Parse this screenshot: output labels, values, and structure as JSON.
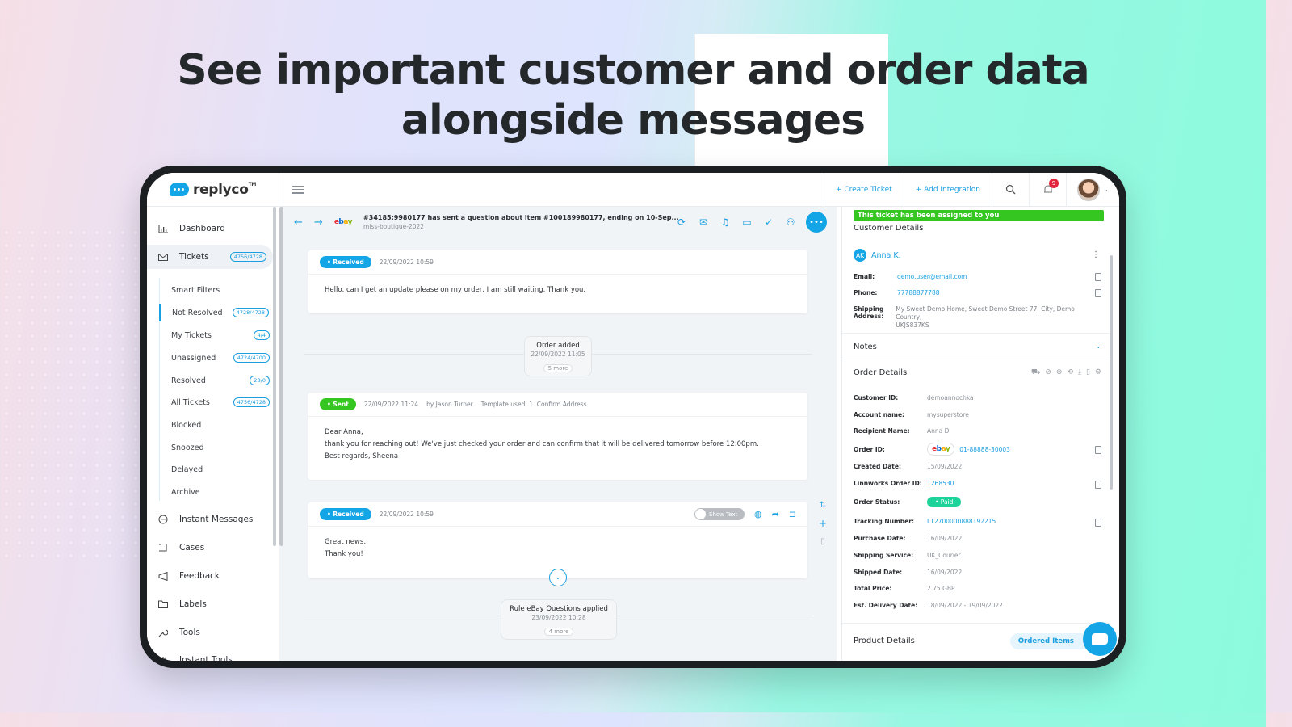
{
  "headline": {
    "line1": "See important customer and order data",
    "line2": "alongside messages"
  },
  "app": {
    "logo_text": "replyco",
    "logo_tm": "TM",
    "topbar": {
      "create_ticket": "+ Create Ticket",
      "add_integration": "+ Add Integration",
      "notification_count": "9"
    }
  },
  "sidebar": {
    "items": [
      {
        "label": "Dashboard",
        "icon": "chart-icon"
      },
      {
        "label": "Tickets",
        "icon": "mail-icon",
        "count": "4756/4728"
      },
      {
        "label": "Instant Messages",
        "icon": "chat-icon"
      },
      {
        "label": "Cases",
        "icon": "case-icon"
      },
      {
        "label": "Feedback",
        "icon": "megaphone-icon"
      },
      {
        "label": "Labels",
        "icon": "folder-icon"
      },
      {
        "label": "Tools",
        "icon": "wrench-icon"
      },
      {
        "label": "Instant Tools",
        "icon": "gear-icon"
      }
    ],
    "ticket_filters": [
      {
        "label": "Smart Filters"
      },
      {
        "label": "Not Resolved",
        "count": "4728/4728"
      },
      {
        "label": "My Tickets",
        "count": "4/4"
      },
      {
        "label": "Unassigned",
        "count": "4724/4700"
      },
      {
        "label": "Resolved",
        "count": "28/0"
      },
      {
        "label": "All Tickets",
        "count": "4756/4728"
      },
      {
        "label": "Blocked"
      },
      {
        "label": "Snoozed"
      },
      {
        "label": "Delayed"
      },
      {
        "label": "Archive"
      }
    ]
  },
  "ticket": {
    "title": "#34185:9980177 has sent a question about item #100189980177, ending on 10-Sep...",
    "account": "miss-boutique-2022",
    "messages": [
      {
        "status": "• Received",
        "time": "22/09/2022 10:59",
        "body": "Hello, can I get an update please on my order, I am still waiting. Thank you."
      },
      {
        "status": "• Sent",
        "time": "22/09/2022 11:24",
        "author": "by Jason Turner",
        "template": "Template used: 1. Confirm Address",
        "body_lines": [
          "Dear Anna,",
          "thank you for reaching out! We've just checked your order and can confirm that it will be delivered tomorrow before 12:00pm.",
          "Best regards, Sheena"
        ]
      },
      {
        "status": "• Received",
        "time": "22/09/2022 10:59",
        "toggle_label": "Show Text",
        "body_lines": [
          "Great news,",
          "Thank you!"
        ]
      }
    ],
    "events": [
      {
        "title": "Order added",
        "time": "22/09/2022 11:05",
        "more": "5 more"
      },
      {
        "title": "Rule eBay Questions applied",
        "time": "23/09/2022 10:28",
        "more": "4 more"
      }
    ]
  },
  "panel": {
    "assigned_banner": "This ticket has been assigned to you",
    "customer_details_title": "Customer Details",
    "customer": {
      "initials": "AK",
      "name": "Anna K.",
      "email_label": "Email:",
      "email": "demo.user@email.com",
      "phone_label": "Phone:",
      "phone": "77788877788",
      "address_label_1": "Shipping",
      "address_label_2": "Address:",
      "address_1": "My Sweet Demo Home, Sweet Demo Street 77, City, Demo Country,",
      "address_2": "UKJS837KS"
    },
    "notes_title": "Notes",
    "order_details_title": "Order Details",
    "order": [
      {
        "label": "Customer ID:",
        "value": "demoannochka"
      },
      {
        "label": "Account name:",
        "value": "mysuperstore"
      },
      {
        "label": "Recipient Name:",
        "value": "Anna D"
      },
      {
        "label": "Order ID:",
        "value": "01-88888-30003"
      },
      {
        "label": "Created Date:",
        "value": "15/09/2022"
      },
      {
        "label": "Linnworks Order ID:",
        "value": "1268530"
      },
      {
        "label": "Order Status:",
        "value": "• Paid"
      },
      {
        "label": "Tracking Number:",
        "value": "L12700000888192215"
      },
      {
        "label": "Purchase Date:",
        "value": "16/09/2022"
      },
      {
        "label": "Shipping Service:",
        "value": "UK_Courier"
      },
      {
        "label": "Shipped Date:",
        "value": "16/09/2022"
      },
      {
        "label": "Total Price:",
        "value": "2.75 GBP"
      },
      {
        "label": "Est. Delivery Date:",
        "value": "18/09/2022 - 19/09/2022"
      }
    ],
    "product_details_title": "Product Details",
    "ordered_items_button": "Ordered Items"
  },
  "colors": {
    "accent": "#13a5e6",
    "sent": "#35c621",
    "paid": "#1ed39a",
    "notification": "#e4263d"
  }
}
